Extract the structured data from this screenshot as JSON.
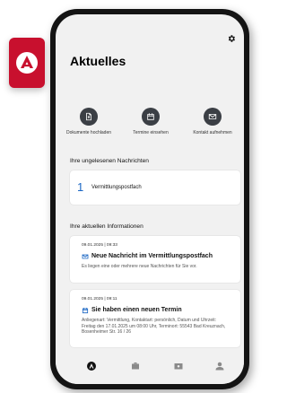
{
  "header": {
    "title": "Aktuelles"
  },
  "actions": [
    {
      "label": "Dokumente hochladen",
      "icon": "document-upload-icon"
    },
    {
      "label": "Termine einsehen",
      "icon": "calendar-icon"
    },
    {
      "label": "Kontakt aufnehmen",
      "icon": "contact-icon"
    }
  ],
  "unread": {
    "heading": "Ihre ungelesenen Nachrichten",
    "items": [
      {
        "count": "1",
        "label": "Vermittlungspostfach"
      }
    ]
  },
  "info": {
    "heading": "Ihre aktuellen Informationen",
    "items": [
      {
        "meta": "09.01.2025 | 09:33",
        "title": "Neue Nachricht im Vermittlungspostfach",
        "body": "Es liegen eine oder mehrere neue Nachrichten für Sie vor.",
        "icon": "mail-icon"
      },
      {
        "meta": "09.01.2025 | 09:11",
        "title": "Sie haben einen neuen Termin",
        "body": "Anliegenart: Vermittlung, Kontaktart: persönlich, Datum und Uhrzeit: Freitag den 17.01.2025 um 08:00 Uhr, Terminort: 55543 Bad Kreuznach, Bosenheimer Str. 16 / 26",
        "icon": "calendar-icon"
      }
    ]
  },
  "tabbar": [
    "home-icon",
    "briefcase-icon",
    "wallet-icon",
    "person-icon"
  ],
  "colors": {
    "brand_red": "#c8102e",
    "accent_blue": "#1a66c4",
    "icon_dark": "#3b3f45"
  }
}
